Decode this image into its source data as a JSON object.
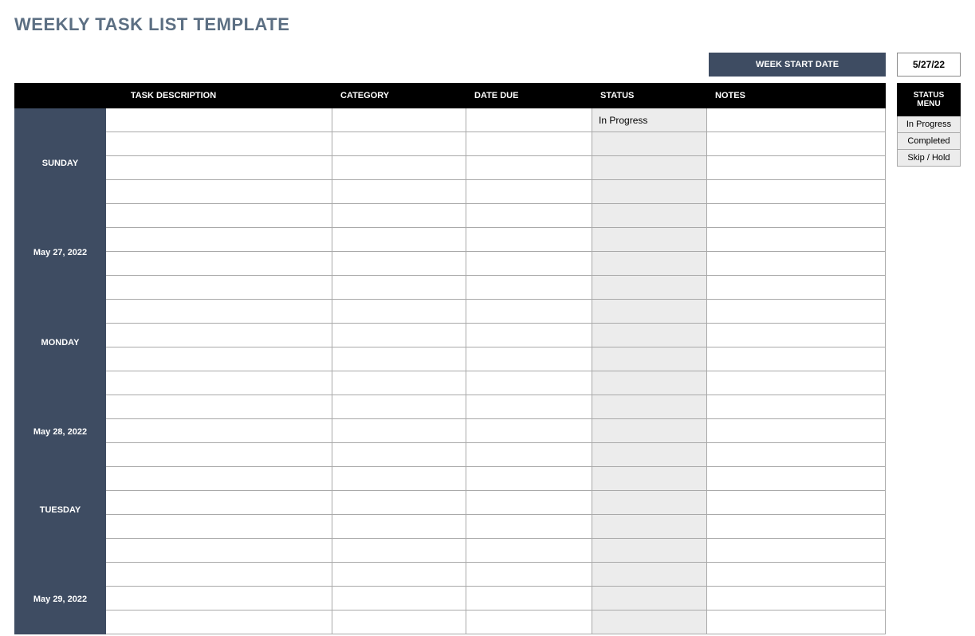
{
  "title": "WEEKLY TASK LIST TEMPLATE",
  "weekStart": {
    "label": "WEEK START DATE",
    "value": "5/27/22"
  },
  "columns": {
    "desc": "TASK DESCRIPTION",
    "category": "CATEGORY",
    "dateDue": "DATE DUE",
    "status": "STATUS",
    "notes": "NOTES"
  },
  "statusMenu": {
    "header": "STATUS MENU",
    "options": [
      "In Progress",
      "Completed",
      "Skip / Hold"
    ]
  },
  "days": [
    {
      "name": "SUNDAY",
      "date": "May 27, 2022",
      "rows": [
        {
          "desc": "",
          "category": "",
          "dateDue": "",
          "status": "In Progress",
          "notes": ""
        },
        {
          "desc": "",
          "category": "",
          "dateDue": "",
          "status": "",
          "notes": ""
        },
        {
          "desc": "",
          "category": "",
          "dateDue": "",
          "status": "",
          "notes": ""
        },
        {
          "desc": "",
          "category": "",
          "dateDue": "",
          "status": "",
          "notes": ""
        },
        {
          "desc": "",
          "category": "",
          "dateDue": "",
          "status": "",
          "notes": ""
        },
        {
          "desc": "",
          "category": "",
          "dateDue": "",
          "status": "",
          "notes": ""
        },
        {
          "desc": "",
          "category": "",
          "dateDue": "",
          "status": "",
          "notes": ""
        },
        {
          "desc": "",
          "category": "",
          "dateDue": "",
          "status": "",
          "notes": ""
        }
      ]
    },
    {
      "name": "MONDAY",
      "date": "May 28, 2022",
      "rows": [
        {
          "desc": "",
          "category": "",
          "dateDue": "",
          "status": "",
          "notes": ""
        },
        {
          "desc": "",
          "category": "",
          "dateDue": "",
          "status": "",
          "notes": ""
        },
        {
          "desc": "",
          "category": "",
          "dateDue": "",
          "status": "",
          "notes": ""
        },
        {
          "desc": "",
          "category": "",
          "dateDue": "",
          "status": "",
          "notes": ""
        },
        {
          "desc": "",
          "category": "",
          "dateDue": "",
          "status": "",
          "notes": ""
        },
        {
          "desc": "",
          "category": "",
          "dateDue": "",
          "status": "",
          "notes": ""
        },
        {
          "desc": "",
          "category": "",
          "dateDue": "",
          "status": "",
          "notes": ""
        }
      ]
    },
    {
      "name": "TUESDAY",
      "date": "May 29, 2022",
      "rows": [
        {
          "desc": "",
          "category": "",
          "dateDue": "",
          "status": "",
          "notes": ""
        },
        {
          "desc": "",
          "category": "",
          "dateDue": "",
          "status": "",
          "notes": ""
        },
        {
          "desc": "",
          "category": "",
          "dateDue": "",
          "status": "",
          "notes": ""
        },
        {
          "desc": "",
          "category": "",
          "dateDue": "",
          "status": "",
          "notes": ""
        },
        {
          "desc": "",
          "category": "",
          "dateDue": "",
          "status": "",
          "notes": ""
        },
        {
          "desc": "",
          "category": "",
          "dateDue": "",
          "status": "",
          "notes": ""
        },
        {
          "desc": "",
          "category": "",
          "dateDue": "",
          "status": "",
          "notes": ""
        }
      ]
    }
  ]
}
